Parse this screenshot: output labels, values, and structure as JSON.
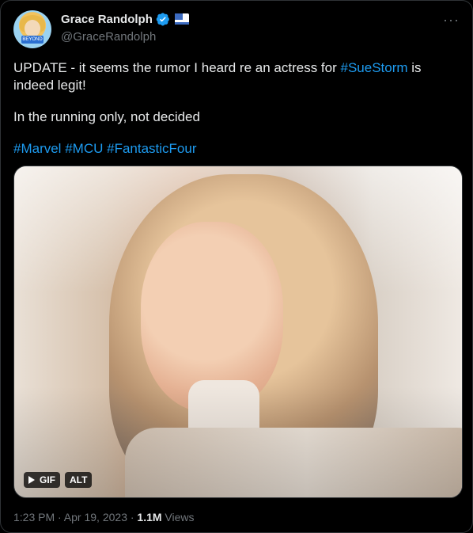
{
  "user": {
    "display_name": "Grace Randolph",
    "handle": "@GraceRandolph",
    "avatar_badge_text": "BEYOND"
  },
  "tweet": {
    "line1_prefix": "UPDATE - it seems the rumor I heard re an actress for ",
    "line1_tag": "#SueStorm",
    "line1_suffix": " is indeed legit!",
    "line2": "In the running only, not decided",
    "tags": [
      "#Marvel",
      "#MCU",
      "#FantasticFour"
    ]
  },
  "media": {
    "gif_label": "GIF",
    "alt_label": "ALT"
  },
  "meta": {
    "timestamp": "1:23 PM · Apr 19, 2023 · ",
    "views_count": "1.1M",
    "views_label": " Views"
  },
  "colors": {
    "background": "#000000",
    "text": "#e7e9ea",
    "muted": "#71767b",
    "link": "#1d9bf0",
    "verified": "#1d9bf0"
  }
}
